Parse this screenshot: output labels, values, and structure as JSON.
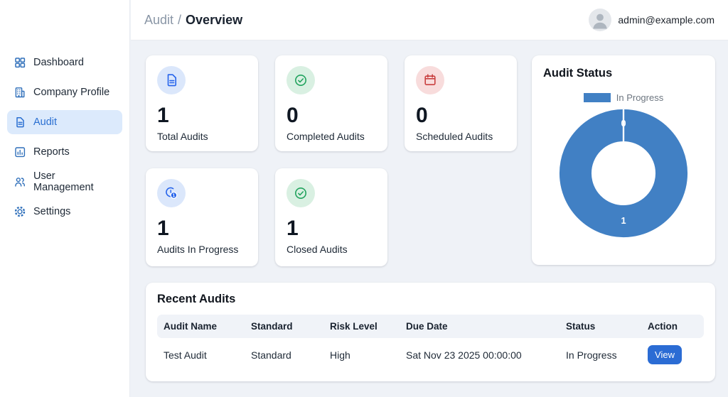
{
  "app": {
    "breadcrumb": {
      "section": "Audit",
      "separator": "/",
      "page": "Overview"
    },
    "user_email": "admin@example.com"
  },
  "sidebar": {
    "items": [
      {
        "label": "Dashboard",
        "icon": "dashboard-grid-icon",
        "active": false
      },
      {
        "label": "Company Profile",
        "icon": "building-icon",
        "active": false
      },
      {
        "label": "Audit",
        "icon": "document-icon",
        "active": true
      },
      {
        "label": "Reports",
        "icon": "bar-chart-icon",
        "active": false
      },
      {
        "label": "User Management",
        "icon": "users-icon",
        "active": false
      },
      {
        "label": "Settings",
        "icon": "gear-icon",
        "active": false
      }
    ]
  },
  "stats": [
    {
      "value": "1",
      "label": "Total Audits",
      "icon": "file-icon",
      "accent": "#2563eb",
      "circle_bg": "#dbe7fb"
    },
    {
      "value": "0",
      "label": "Completed Audits",
      "icon": "check-circle-icon",
      "accent": "#22a35e",
      "circle_bg": "#d9f0e2"
    },
    {
      "value": "0",
      "label": "Scheduled Audits",
      "icon": "calendar-icon",
      "accent": "#c94040",
      "circle_bg": "#f8dcdc"
    },
    {
      "value": "1",
      "label": "Audits In Progress",
      "icon": "clock-badge-icon",
      "badge": "1",
      "accent": "#2563eb",
      "circle_bg": "#dbe7fb"
    },
    {
      "value": "1",
      "label": "Closed Audits",
      "icon": "check-circle-icon",
      "accent": "#22a35e",
      "circle_bg": "#d9f0e2"
    }
  ],
  "chart_data": {
    "type": "pie",
    "subtype": "doughnut",
    "title": "Audit Status",
    "segments": [
      {
        "label": "In Progress",
        "value": 1,
        "color": "#4180c4"
      }
    ],
    "value_labels": {
      "top": "0",
      "bottom": "1"
    },
    "legend": {
      "position": "top",
      "entries": [
        {
          "label": "In Progress",
          "color": "#4180c4"
        }
      ]
    }
  },
  "recent_audits": {
    "title": "Recent Audits",
    "columns": [
      "Audit Name",
      "Standard",
      "Risk Level",
      "Due Date",
      "Status",
      "Action"
    ],
    "rows": [
      {
        "audit_name": "Test Audit",
        "standard": "Standard",
        "risk_level": "High",
        "due_date": "Sat Nov 23 2025 00:00:00",
        "status": "In Progress",
        "action_label": "View"
      }
    ]
  },
  "colors": {
    "accent_blue": "#2b6cd4",
    "chart_blue": "#4180c4",
    "sidebar_active_bg": "#dceafc",
    "content_bg": "#eff2f7",
    "green": "#22a35e",
    "red": "#c94040"
  }
}
